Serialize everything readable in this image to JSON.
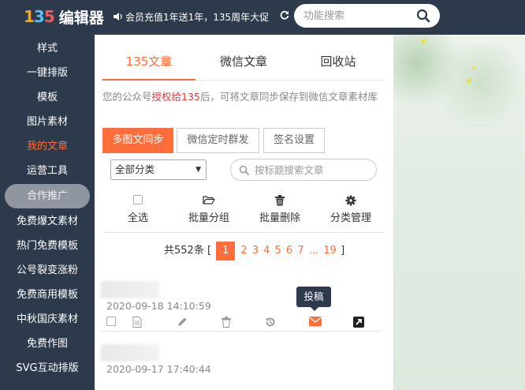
{
  "header": {
    "logo_mark": "135",
    "logo_text": "编辑器",
    "promo_text": "会员充值1年送1年，135周年大促",
    "search_placeholder": "功能搜索",
    "refresh_icon": "refresh-icon",
    "help_icon": "question-circle-icon"
  },
  "sidebar": {
    "items": [
      {
        "label": "样式"
      },
      {
        "label": "一键排版"
      },
      {
        "label": "模板"
      },
      {
        "label": "图片素材"
      },
      {
        "label": "我的文章"
      },
      {
        "label": "运营工具"
      },
      {
        "label": "合作推广"
      },
      {
        "label": "免费爆文素材"
      },
      {
        "label": "热门免费模板"
      },
      {
        "label": "公号裂变涨粉"
      },
      {
        "label": "免费商用模板"
      },
      {
        "label": "中秋国庆素材"
      },
      {
        "label": "免费作图"
      },
      {
        "label": "SVG互动排版"
      }
    ],
    "active_index": 4
  },
  "panel": {
    "tabs": [
      {
        "label": "135文章"
      },
      {
        "label": "微信文章"
      },
      {
        "label": "回收站"
      }
    ],
    "notice_prefix": "您的公众号",
    "notice_highlight": "授权给135",
    "notice_suffix": "后，可将文章同步保存到微信文章素材库",
    "buttons": {
      "sync": "多图文同步",
      "schedule": "微信定时群发",
      "signature": "签名设置"
    },
    "category_select": "全部分类",
    "article_search_placeholder": "按标题搜索文章",
    "actions": [
      {
        "label": "全选",
        "icon": "checkbox-icon"
      },
      {
        "label": "批量分组",
        "icon": "folder-open-icon"
      },
      {
        "label": "批量删除",
        "icon": "trash-icon"
      },
      {
        "label": "分类管理",
        "icon": "gear-icon"
      }
    ],
    "pager": {
      "total_text": "共552条 [",
      "current": "1",
      "pages": [
        "2",
        "3",
        "4",
        "5",
        "6",
        "7"
      ],
      "ellipsis": "...",
      "last": "19",
      "close_bracket": "]"
    },
    "articles": [
      {
        "date": "2020-09-18 14:10:59"
      },
      {
        "date": "2020-09-17 17:40:44"
      }
    ],
    "tooltip": "投稿"
  },
  "colors": {
    "accent": "#ff6d3a",
    "nav_bg": "#2d3a4b",
    "highlight_red": "#e4393c"
  }
}
